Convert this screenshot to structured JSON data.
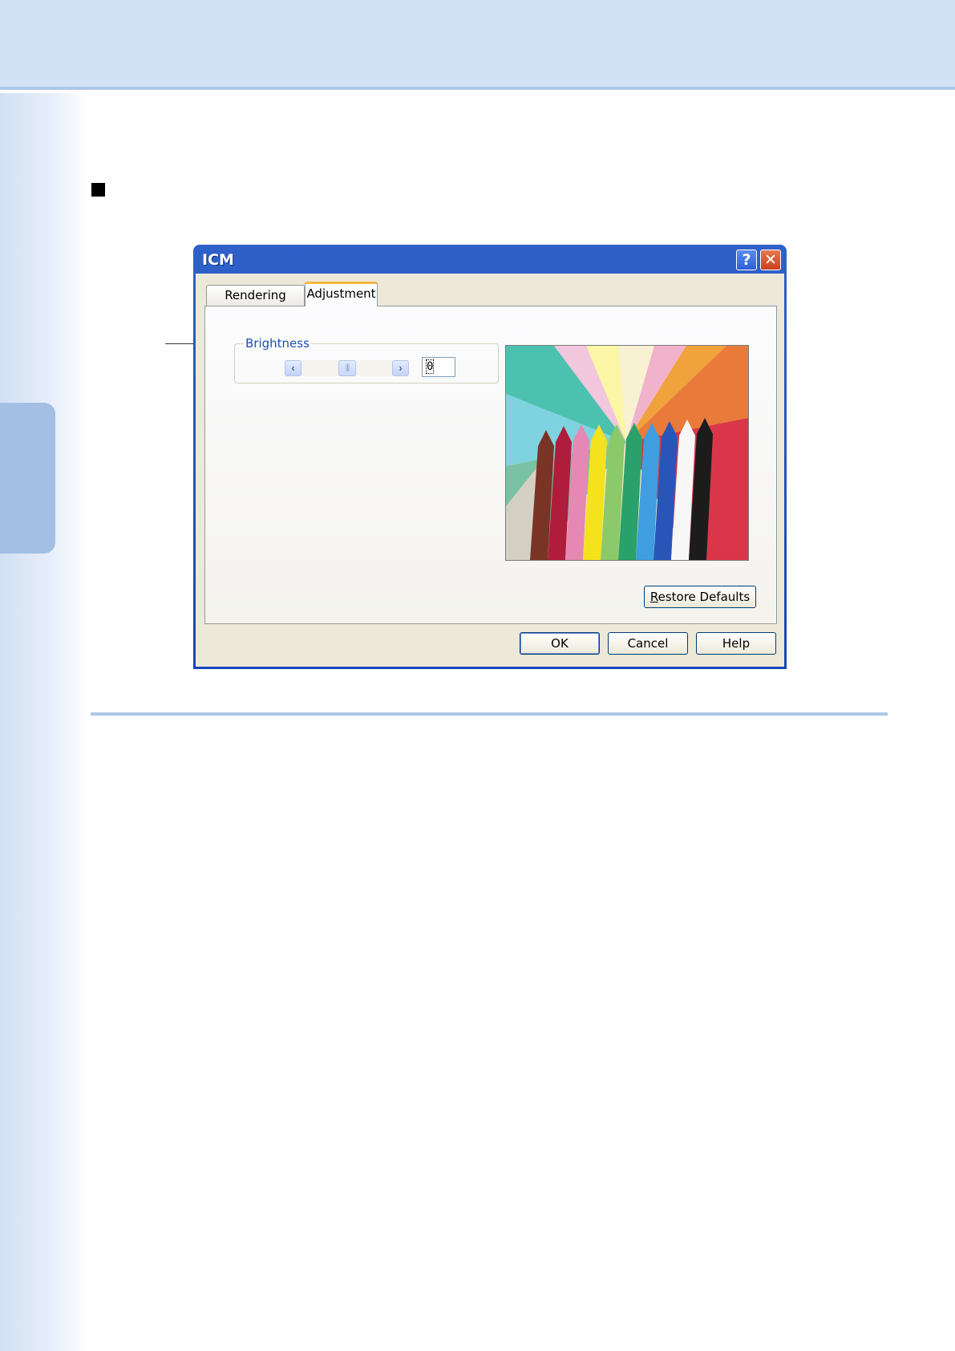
{
  "dialog": {
    "title": "ICM",
    "help_glyph": "?",
    "close_glyph": "✕",
    "tabs": [
      {
        "label": "Rendering Intent",
        "active": false
      },
      {
        "label": "Adjustment",
        "active": true
      }
    ],
    "brightness": {
      "label": "Brightness",
      "value": "0",
      "slider_position": 0.5,
      "left_arrow": "‹",
      "right_arrow": "›",
      "thumb_grip": "|||"
    },
    "restore_defaults": {
      "accel": "R",
      "rest": "estore Defaults"
    },
    "buttons": {
      "ok": "OK",
      "cancel": "Cancel",
      "help": "Help"
    },
    "preview_image": "crayons-on-colored-paper"
  },
  "colors": {
    "header_band": "#d2e2f6",
    "side_tab": "#a3bfe4",
    "rule": "#aec7e8",
    "titlebar": "#2f61c9"
  }
}
